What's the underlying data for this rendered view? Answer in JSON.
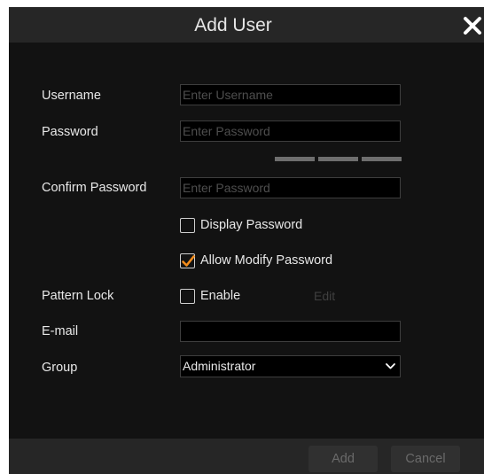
{
  "dialog": {
    "title": "Add User"
  },
  "form": {
    "username": {
      "label": "Username",
      "placeholder": "Enter Username",
      "value": ""
    },
    "password": {
      "label": "Password",
      "placeholder": "Enter Password",
      "value": ""
    },
    "confirm_password": {
      "label": "Confirm Password",
      "placeholder": "Enter Password",
      "value": ""
    },
    "display_password": {
      "label": "Display Password",
      "checked": false
    },
    "allow_modify_password": {
      "label": "Allow Modify Password",
      "checked": true
    },
    "pattern_lock": {
      "label": "Pattern Lock",
      "enable_label": "Enable",
      "checked": false,
      "edit_label": "Edit"
    },
    "email": {
      "label": "E-mail",
      "value": ""
    },
    "group": {
      "label": "Group",
      "selected": "Administrator"
    }
  },
  "footer": {
    "add_label": "Add",
    "cancel_label": "Cancel"
  },
  "colors": {
    "accent": "#f28c1c",
    "dialog_bg": "#121212",
    "bar_bg": "#262626"
  },
  "icons": {
    "close": "close-icon",
    "check": "checkmark-icon",
    "dropdown": "chevron-down-icon"
  }
}
